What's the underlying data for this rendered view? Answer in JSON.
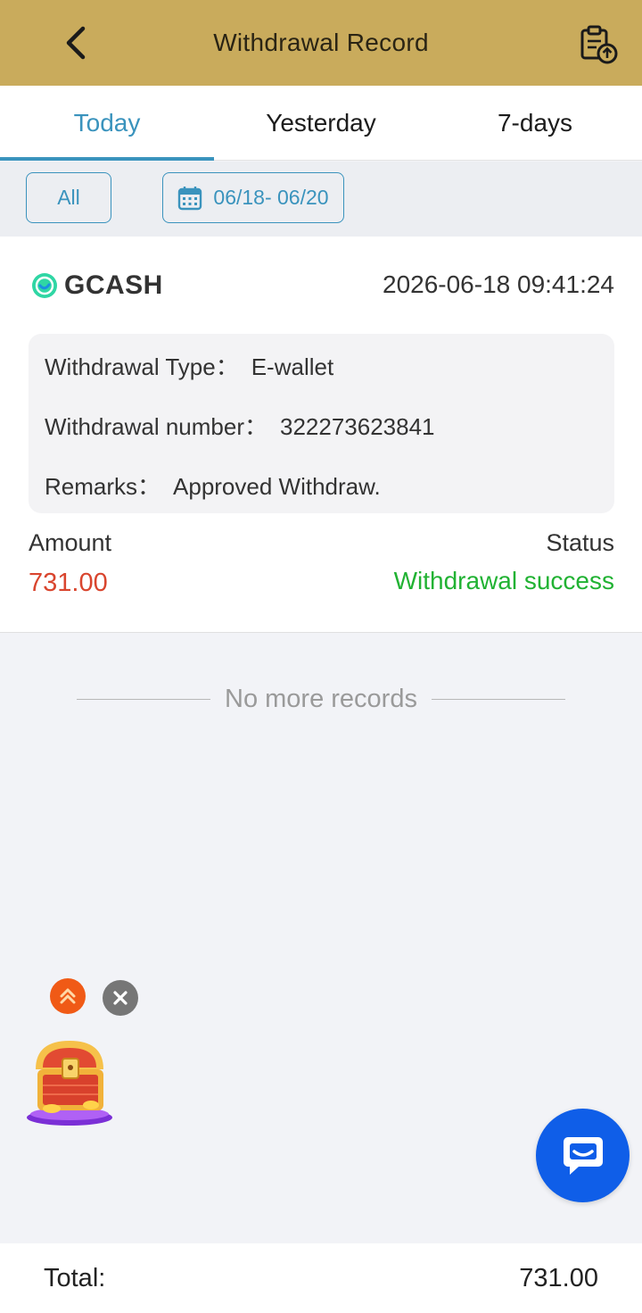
{
  "header": {
    "title": "Withdrawal Record"
  },
  "tabs": [
    {
      "label": "Today",
      "active": true
    },
    {
      "label": "Yesterday",
      "active": false
    },
    {
      "label": "7-days",
      "active": false
    }
  ],
  "filters": {
    "all_label": "All",
    "date_range": "06/18- 06/20"
  },
  "record": {
    "brand": "GCASH",
    "timestamp": "2026-06-18 09:41:24",
    "type_label": "Withdrawal Type：",
    "type_value": "E-wallet",
    "number_label": "Withdrawal number：",
    "number_value": "322273623841",
    "remarks_label": "Remarks：",
    "remarks_value": "Approved Withdraw.",
    "amount_label": "Amount",
    "amount_value": "731.00",
    "status_label": "Status",
    "status_value": "Withdrawal success"
  },
  "list": {
    "end_text": "No more records"
  },
  "footer": {
    "total_label": "Total:",
    "total_value": "731.00"
  },
  "icons": {
    "back": "chevron-left-icon",
    "record": "clipboard-upload-icon",
    "calendar": "calendar-icon",
    "brand": "gcash-logo-icon",
    "up": "double-chevron-up-icon",
    "close": "close-icon",
    "chest": "treasure-chest-icon",
    "chat": "chat-bubble-icon"
  },
  "colors": {
    "header_bg": "#c9ab5c",
    "accent": "#3a93bd",
    "amount": "#d9452e",
    "success": "#21b233",
    "chat": "#0f5ee8"
  }
}
